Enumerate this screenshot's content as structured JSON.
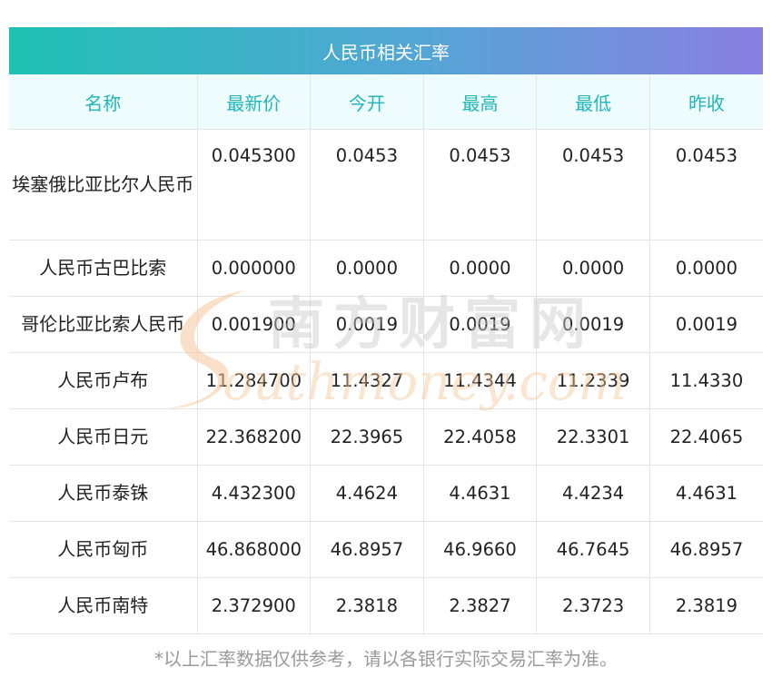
{
  "title": "人民币相关汇率",
  "columns": [
    "名称",
    "最新价",
    "今开",
    "最高",
    "最低",
    "昨收"
  ],
  "rows": [
    {
      "name": "埃塞俄比亚比尔人民币",
      "latest": "0.045300",
      "open": "0.0453",
      "high": "0.0453",
      "low": "0.0453",
      "prev_close": "0.0453"
    },
    {
      "name": "人民币古巴比索",
      "latest": "0.000000",
      "open": "0.0000",
      "high": "0.0000",
      "low": "0.0000",
      "prev_close": "0.0000"
    },
    {
      "name": "哥伦比亚比索人民币",
      "latest": "0.001900",
      "open": "0.0019",
      "high": "0.0019",
      "low": "0.0019",
      "prev_close": "0.0019"
    },
    {
      "name": "人民币卢布",
      "latest": "11.284700",
      "open": "11.4327",
      "high": "11.4344",
      "low": "11.2339",
      "prev_close": "11.4330"
    },
    {
      "name": "人民币日元",
      "latest": "22.368200",
      "open": "22.3965",
      "high": "22.4058",
      "low": "22.3301",
      "prev_close": "22.4065"
    },
    {
      "name": "人民币泰铢",
      "latest": "4.432300",
      "open": "4.4624",
      "high": "4.4631",
      "low": "4.4234",
      "prev_close": "4.4631"
    },
    {
      "name": "人民币匈币",
      "latest": "46.868000",
      "open": "46.8957",
      "high": "46.9660",
      "low": "46.7645",
      "prev_close": "46.8957"
    },
    {
      "name": "人民币南特",
      "latest": "2.372900",
      "open": "2.3818",
      "high": "2.3827",
      "low": "2.3723",
      "prev_close": "2.3819"
    }
  ],
  "watermark": {
    "cn": "南方财富网",
    "en": "outhmoney.com",
    "colors": {
      "orange": "#f5c79a",
      "grey": "#c9c9c9"
    }
  },
  "footnote": "*以上汇率数据仅供参考，请以各银行实际交易汇率为准。",
  "colors": {
    "header_text": "#20b6b8",
    "header_bg": "#eefcfd",
    "gradient_start": "#1fc1b3",
    "gradient_end": "#8a7fe0"
  }
}
